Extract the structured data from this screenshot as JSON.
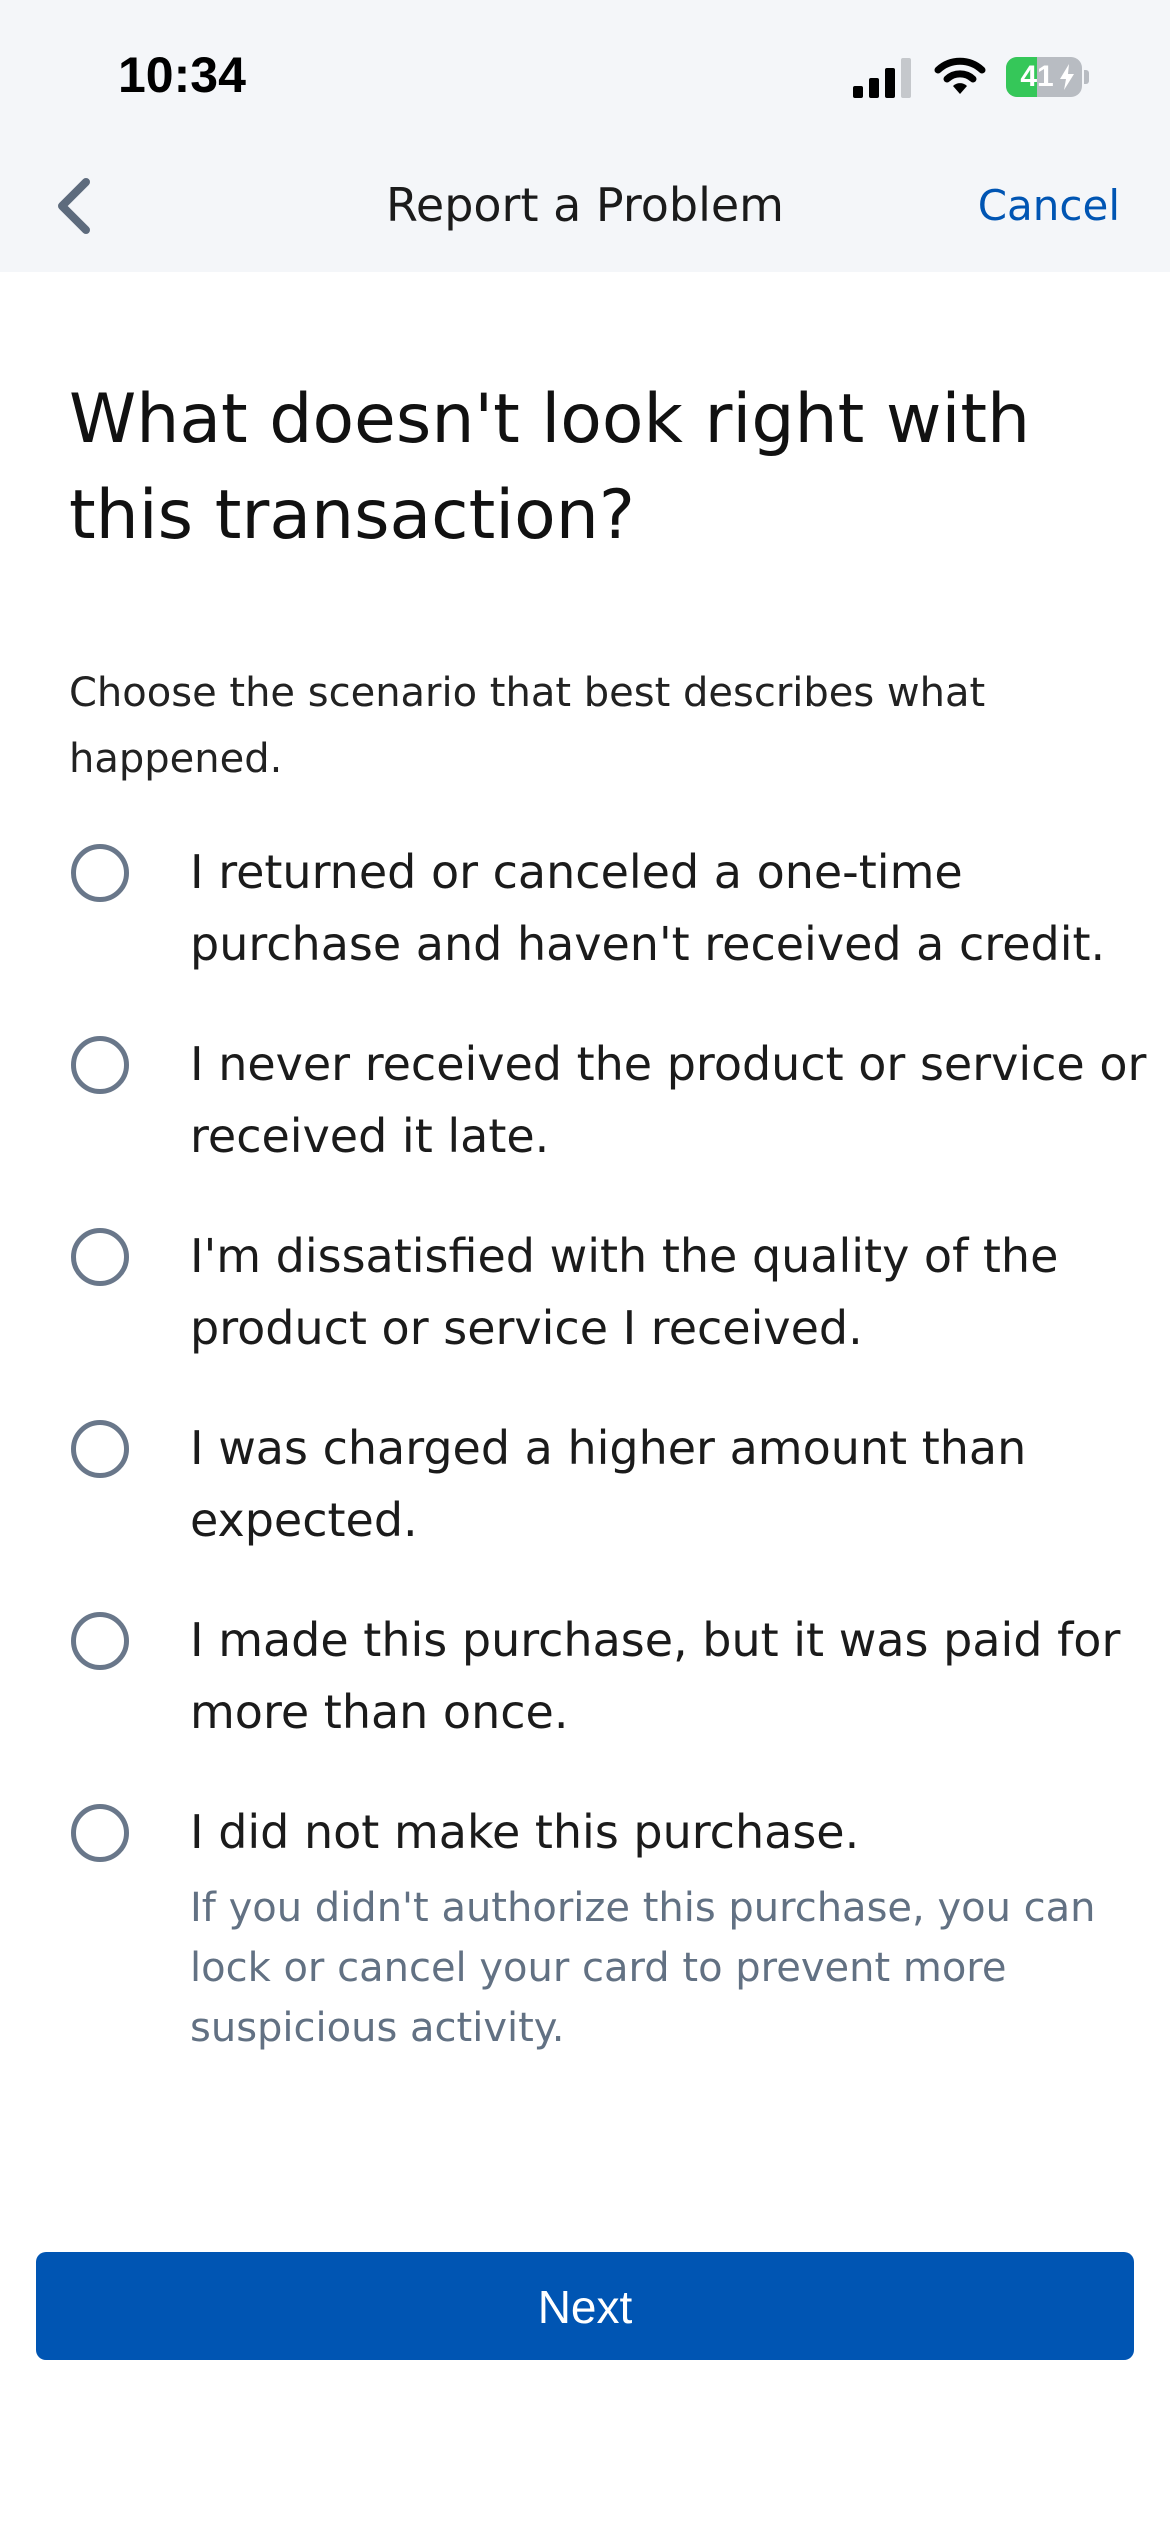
{
  "status_bar": {
    "time": "10:34",
    "battery_level": "41",
    "battery_fraction": 0.41,
    "icons": [
      "cellular-signal-icon",
      "wifi-icon",
      "battery-charging-icon"
    ]
  },
  "header": {
    "back_icon": "chevron-left-icon",
    "title": "Report a Problem",
    "cancel_label": "Cancel"
  },
  "main": {
    "heading": "What doesn't look right with this transaction?",
    "subtitle": "Choose the scenario that best describes what happened.",
    "options": [
      {
        "label": "I returned or canceled a one-time purchase and haven't received a credit.",
        "selected": false
      },
      {
        "label": "I never received the product or service or received it late.",
        "selected": false
      },
      {
        "label": "I'm dissatisfied with the quality of the product or service I received.",
        "selected": false
      },
      {
        "label": "I was charged a higher amount than expected.",
        "selected": false
      },
      {
        "label": "I made this purchase, but it was paid for more than once.",
        "selected": false
      },
      {
        "label": "I did not make this purchase.",
        "help": "If you didn't authorize this purchase, you can lock or cancel your card to prevent more suspicious activity.",
        "selected": false
      }
    ]
  },
  "footer": {
    "next_label": "Next"
  },
  "colors": {
    "accent": "#0055b3",
    "header_background": "#f4f6f9",
    "radio_border": "#69778a",
    "help_text": "#627183",
    "battery_fill": "#35c759"
  }
}
